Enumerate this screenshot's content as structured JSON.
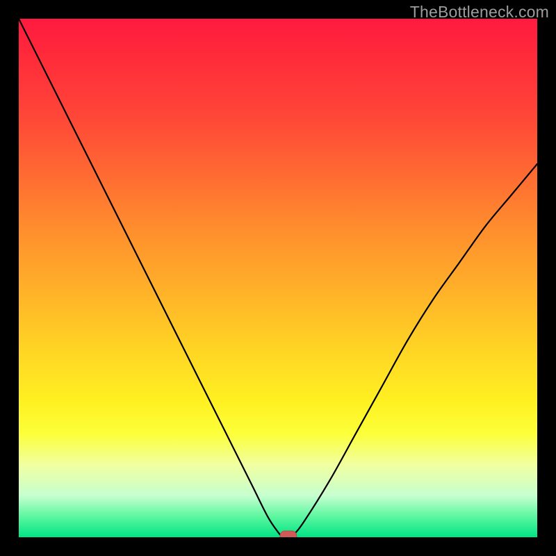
{
  "watermark": "TheBottleneck.com",
  "colors": {
    "frame": "#000000",
    "gradient_top": "#ff1a40",
    "gradient_mid": "#ffd524",
    "gradient_bottom": "#00e383",
    "curve": "#000000",
    "marker": "#cf5a57"
  },
  "chart_data": {
    "type": "line",
    "title": "",
    "xlabel": "",
    "ylabel": "",
    "xlim": [
      0,
      100
    ],
    "ylim": [
      0,
      100
    ],
    "x": [
      0,
      5,
      10,
      15,
      20,
      25,
      30,
      35,
      40,
      45,
      48,
      50,
      51,
      52,
      53,
      55,
      60,
      65,
      70,
      75,
      80,
      85,
      90,
      95,
      100
    ],
    "y": [
      100,
      90,
      80,
      70,
      60,
      50,
      40,
      30,
      20,
      10,
      4,
      1,
      0,
      0,
      0.5,
      3,
      11,
      20,
      29,
      38,
      46,
      53,
      60,
      66,
      72
    ],
    "marker": {
      "x": 52,
      "y": 0
    },
    "annotations": []
  }
}
